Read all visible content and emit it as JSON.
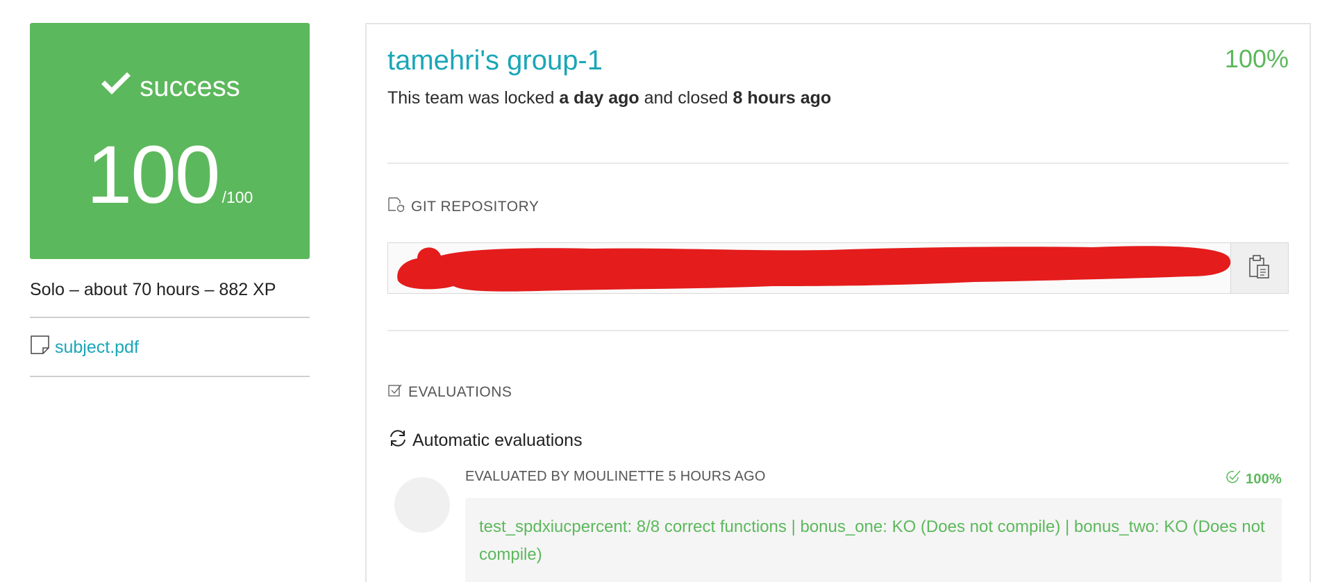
{
  "grade": {
    "status": "success",
    "score": "100",
    "max": "/100"
  },
  "project": {
    "meta": "Solo – about 70 hours – 882 XP",
    "subject_link": "subject.pdf"
  },
  "team": {
    "name": "tamehri's group-1",
    "percent": "100%",
    "lock_prefix": "This team was locked ",
    "locked_when": "a day ago",
    "lock_middle": " and closed ",
    "closed_when": "8 hours ago"
  },
  "repository": {
    "title": "GIT REPOSITORY",
    "url": ""
  },
  "evaluations": {
    "title": "EVALUATIONS",
    "automatic_title": "Automatic evaluations",
    "items": [
      {
        "header": "EVALUATED BY MOULINETTE 5 HOURS AGO",
        "score": "100%",
        "comment": "test_spdxiucpercent: 8/8 correct functions | bonus_one: KO (Does not compile) | bonus_two: KO (Does not compile)"
      }
    ]
  },
  "colors": {
    "success": "#5cb85c",
    "link": "#1aa6b7",
    "redaction": "#e41c1c"
  },
  "icons": {
    "status": "check-icon",
    "subject": "file-icon",
    "repository": "git-file-icon",
    "copy": "clipboard-icon",
    "evaluations": "checkbox-icon",
    "automatic": "sync-icon",
    "eval_score": "check-circle-icon"
  }
}
